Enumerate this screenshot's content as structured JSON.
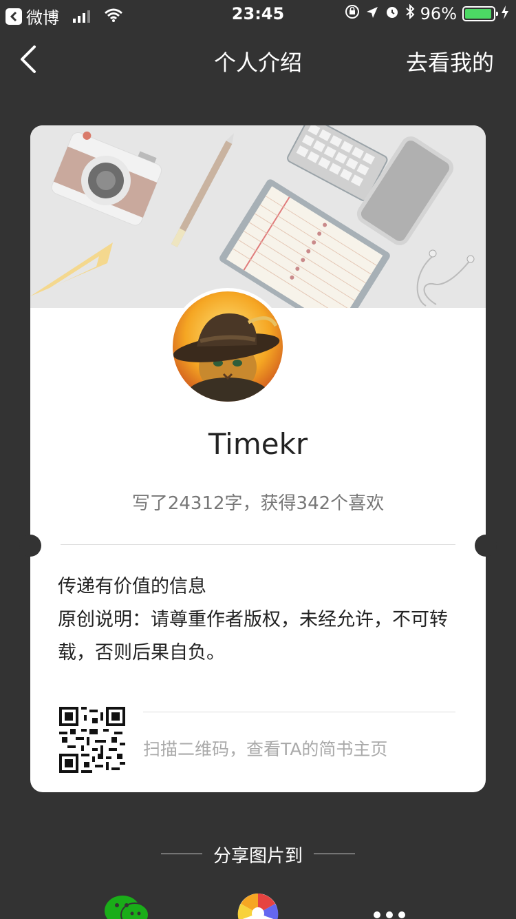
{
  "status_bar": {
    "carrier": "微博",
    "time": "23:45",
    "battery": "96%",
    "battery_level": 0.96
  },
  "nav": {
    "title": "个人介绍",
    "right_link": "去看我的"
  },
  "profile": {
    "username": "Timekr",
    "stats": "写了24312字，获得342个喜欢",
    "description_line1": "传递有价值的信息",
    "description_line2": "原创说明：请尊重作者版权，未经允许，不可转载，否则后果自负。",
    "qr_caption": "扫描二维码，查看TA的简书主页"
  },
  "share": {
    "title": "分享图片到",
    "targets": [
      "wechat-icon",
      "moments-icon",
      "more-icon"
    ]
  },
  "colors": {
    "background": "#333333",
    "card": "#ffffff",
    "battery": "#4cd964",
    "wechat": "#1aad19"
  }
}
